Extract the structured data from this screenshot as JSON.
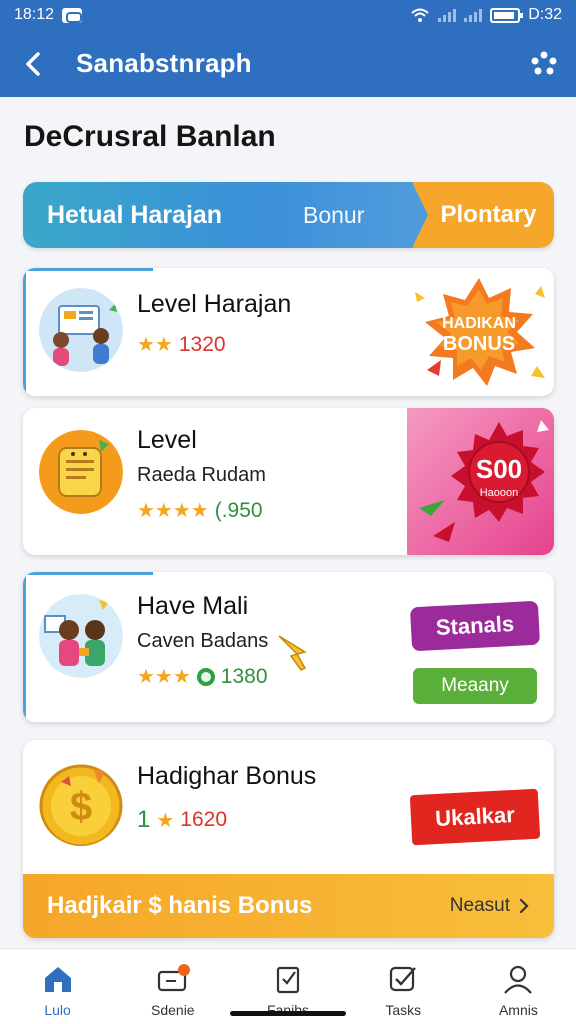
{
  "status_bar": {
    "time": "18:12",
    "right_time": "D:32"
  },
  "app_bar": {
    "title": "Sanabstnraph",
    "back_icon": "chevron-left-icon",
    "menu_icon": "menu-dots-icon"
  },
  "page": {
    "heading": "DeCrusral Banlan"
  },
  "banner": {
    "left_text": "Hetual Harajan",
    "bonus_text": "Bonur",
    "right_text": "Plontary"
  },
  "cards": [
    {
      "title": "Level Harajan",
      "subtitle": "",
      "stars": "★★",
      "rating_value": "1320",
      "badge_line1": "HADIKAN",
      "badge_line2": "BONUS"
    },
    {
      "title": "Level",
      "subtitle": "Raeda Rudam",
      "stars": "★★★★",
      "rating_value": "(.950",
      "badge_line1": "S00",
      "badge_line2": "Haooon"
    },
    {
      "title": "Have Mali",
      "subtitle": "Caven Badans",
      "stars": "★★★",
      "rating_value": "1380",
      "badge_line1": "Stanals",
      "badge_line2": "Meaany"
    },
    {
      "title": "Hadighar Bonus",
      "subtitle": "",
      "prefix": "1",
      "stars": "★",
      "rating_value": "1620",
      "badge_line1": "Ukalkar",
      "footer_text": "Hadjkair $ hanis Bonus",
      "footer_link": "Neasut"
    }
  ],
  "bottom_nav": [
    {
      "label": "Lulo",
      "icon": "home-icon",
      "active": true
    },
    {
      "label": "Sdenie",
      "icon": "ticket-icon",
      "active": false
    },
    {
      "label": "Fanibs",
      "icon": "clipboard-icon",
      "active": false
    },
    {
      "label": "Tasks",
      "icon": "checkbox-icon",
      "active": false
    },
    {
      "label": "Amnis",
      "icon": "profile-icon",
      "active": false
    }
  ],
  "colors": {
    "primary": "#2e6fc0",
    "accent_orange": "#f6a62a",
    "star": "#f3a622"
  }
}
